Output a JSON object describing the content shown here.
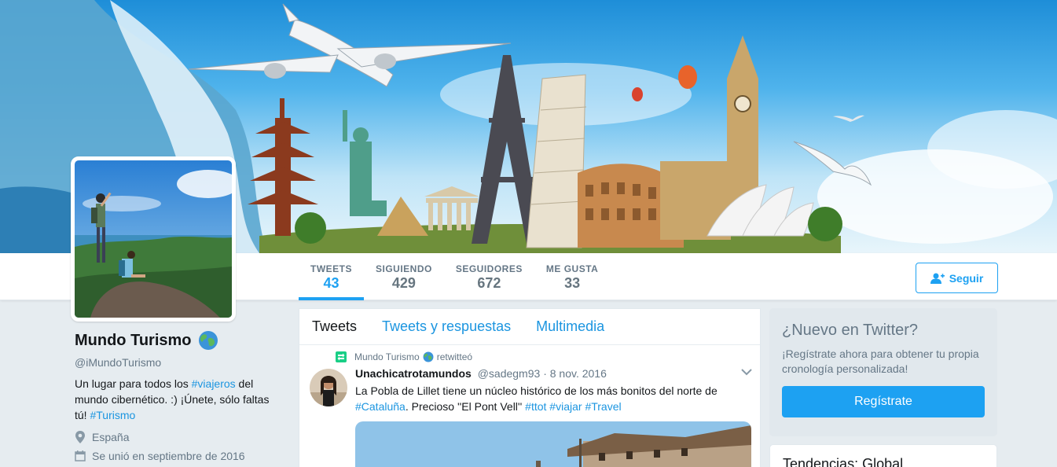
{
  "profile": {
    "name": "Mundo Turismo",
    "handle": "@iMundoTurismo",
    "bio_prefix": "Un lugar para todos los ",
    "bio_tag1": "#viajeros",
    "bio_mid": " del mundo cibernético. :) ¡Únete, sólo faltas tú! ",
    "bio_tag2": "#Turismo",
    "location": "España",
    "joined": "Se unió en septiembre de 2016"
  },
  "nav": {
    "stats": [
      {
        "label": "TWEETS",
        "value": "43"
      },
      {
        "label": "SIGUIENDO",
        "value": "429"
      },
      {
        "label": "SEGUIDORES",
        "value": "672"
      },
      {
        "label": "ME GUSTA",
        "value": "33"
      }
    ],
    "follow_label": "Seguir"
  },
  "timeline": {
    "tabs": [
      "Tweets",
      "Tweets y respuestas",
      "Multimedia"
    ],
    "retweet_by": "Mundo Turismo",
    "retweet_suffix": "retwitteó",
    "tweet": {
      "author": "Unachicatrotamundos",
      "handle": "@sadegm93",
      "date": "8 nov. 2016",
      "text_prefix": "La Pobla de Lillet tiene un núcleo histórico de los más bonitos del norte de ",
      "tag_cataluna": "#Cataluña",
      "text_mid": ". Precioso ''El Pont Vell'' ",
      "tag_ttot": "#ttot",
      "tag_viajar": "#viajar",
      "tag_travel": "#Travel"
    }
  },
  "signup": {
    "title": "¿Nuevo en Twitter?",
    "text": "¡Regístrate ahora para obtener tu propia cronología personalizada!",
    "button": "Regístrate"
  },
  "trends": {
    "title": "Tendencias: Global"
  },
  "colors": {
    "accent": "#1da1f2",
    "link": "#1b95e0",
    "background": "#e6ecf0"
  }
}
